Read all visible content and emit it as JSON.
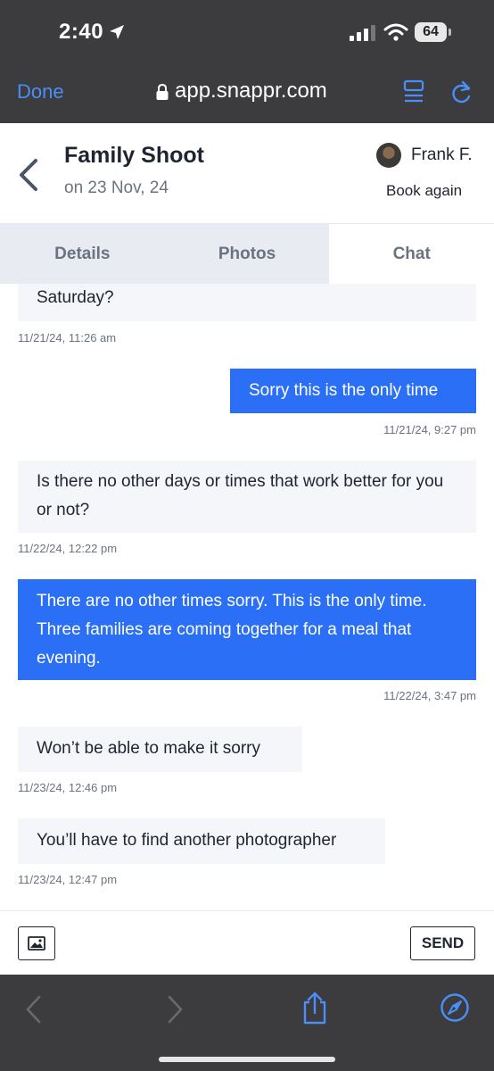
{
  "status_bar": {
    "time": "2:40",
    "battery": "64"
  },
  "browser": {
    "done_label": "Done",
    "url": "app.snappr.com",
    "accent_color": "#4a8ef7"
  },
  "header": {
    "title": "Family Shoot",
    "subtitle": "on 23 Nov, 24",
    "photographer": "Frank F.",
    "book_again": "Book again"
  },
  "tabs": [
    {
      "label": "Details",
      "active": false
    },
    {
      "label": "Photos",
      "active": false
    },
    {
      "label": "Chat",
      "active": true
    }
  ],
  "messages": [
    {
      "direction": "in",
      "text": "Saturday?",
      "time": "11/21/24, 11:26 am"
    },
    {
      "direction": "out",
      "text": "Sorry this is the only time",
      "time": "11/21/24, 9:27 pm"
    },
    {
      "direction": "in",
      "text": "Is there no other days or times that work better for you or not?",
      "time": "11/22/24, 12:22 pm"
    },
    {
      "direction": "out",
      "text": "There are no other times sorry. This is the only time. Three families are coming together for a meal that evening.",
      "time": "11/22/24, 3:47 pm"
    },
    {
      "direction": "in",
      "text": "Won’t be able to make it sorry",
      "time": "11/23/24, 12:46 pm"
    },
    {
      "direction": "in",
      "text": "You’ll have to find another photographer",
      "time": "11/23/24, 12:47 pm"
    }
  ],
  "composer": {
    "send_label": "SEND"
  },
  "colors": {
    "outgoing_bubble": "#2a6ff5",
    "incoming_bubble": "#f4f6fa",
    "browser_chrome": "#3c3c3e"
  }
}
